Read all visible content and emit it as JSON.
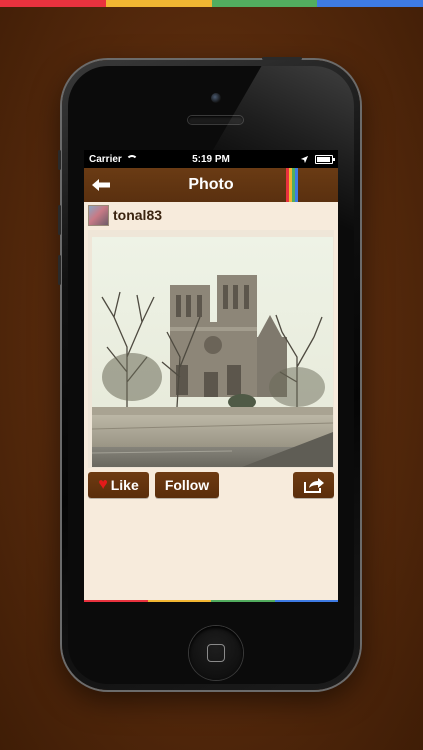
{
  "colors": {
    "brand_red": "#e9323e",
    "brand_yellow": "#f1b632",
    "brand_green": "#52ad5f",
    "brand_blue": "#3e7be4",
    "navbar_brown": "#6a3b14",
    "button_brown": "#6e3b12",
    "screen_bg": "#f7ebdc"
  },
  "status_bar": {
    "carrier": "Carrier",
    "time": "5:19 PM"
  },
  "nav": {
    "title": "Photo",
    "back_icon": "arrow-left-icon"
  },
  "post": {
    "username": "tonal83",
    "photo_alt": "Notre-Dame cathedral beside the Seine"
  },
  "actions": {
    "like_label": "Like",
    "follow_label": "Follow",
    "share_icon": "share-icon"
  }
}
